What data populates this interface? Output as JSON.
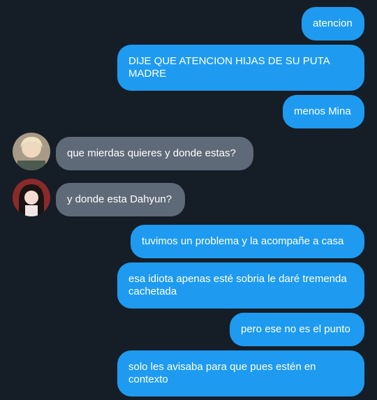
{
  "messages": [
    {
      "side": "out",
      "text": "atencion"
    },
    {
      "side": "out",
      "text": "DIJE QUE ATENCION HIJAS DE SU PUTA MADRE"
    },
    {
      "side": "out",
      "text": "menos Mina"
    },
    {
      "side": "in",
      "text": "que mierdas quieres y donde estas?",
      "avatar": "avatar-blonde-person-icon"
    },
    {
      "side": "in",
      "text": "y donde esta Dahyun?",
      "avatar": "avatar-dark-hair-person-icon"
    },
    {
      "side": "out",
      "text": "tuvimos un problema y la acompañe a casa"
    },
    {
      "side": "out",
      "text": "esa idiota apenas esté sobria le daré tremenda cachetada"
    },
    {
      "side": "out",
      "text": "pero ese no es el punto"
    },
    {
      "side": "out",
      "text": "solo les avisaba para que pues estén en contexto"
    }
  ],
  "colors": {
    "background": "#151d27",
    "outgoing_bubble": "#1e9bf0",
    "incoming_bubble": "#5f6a78",
    "text": "#ffffff"
  }
}
